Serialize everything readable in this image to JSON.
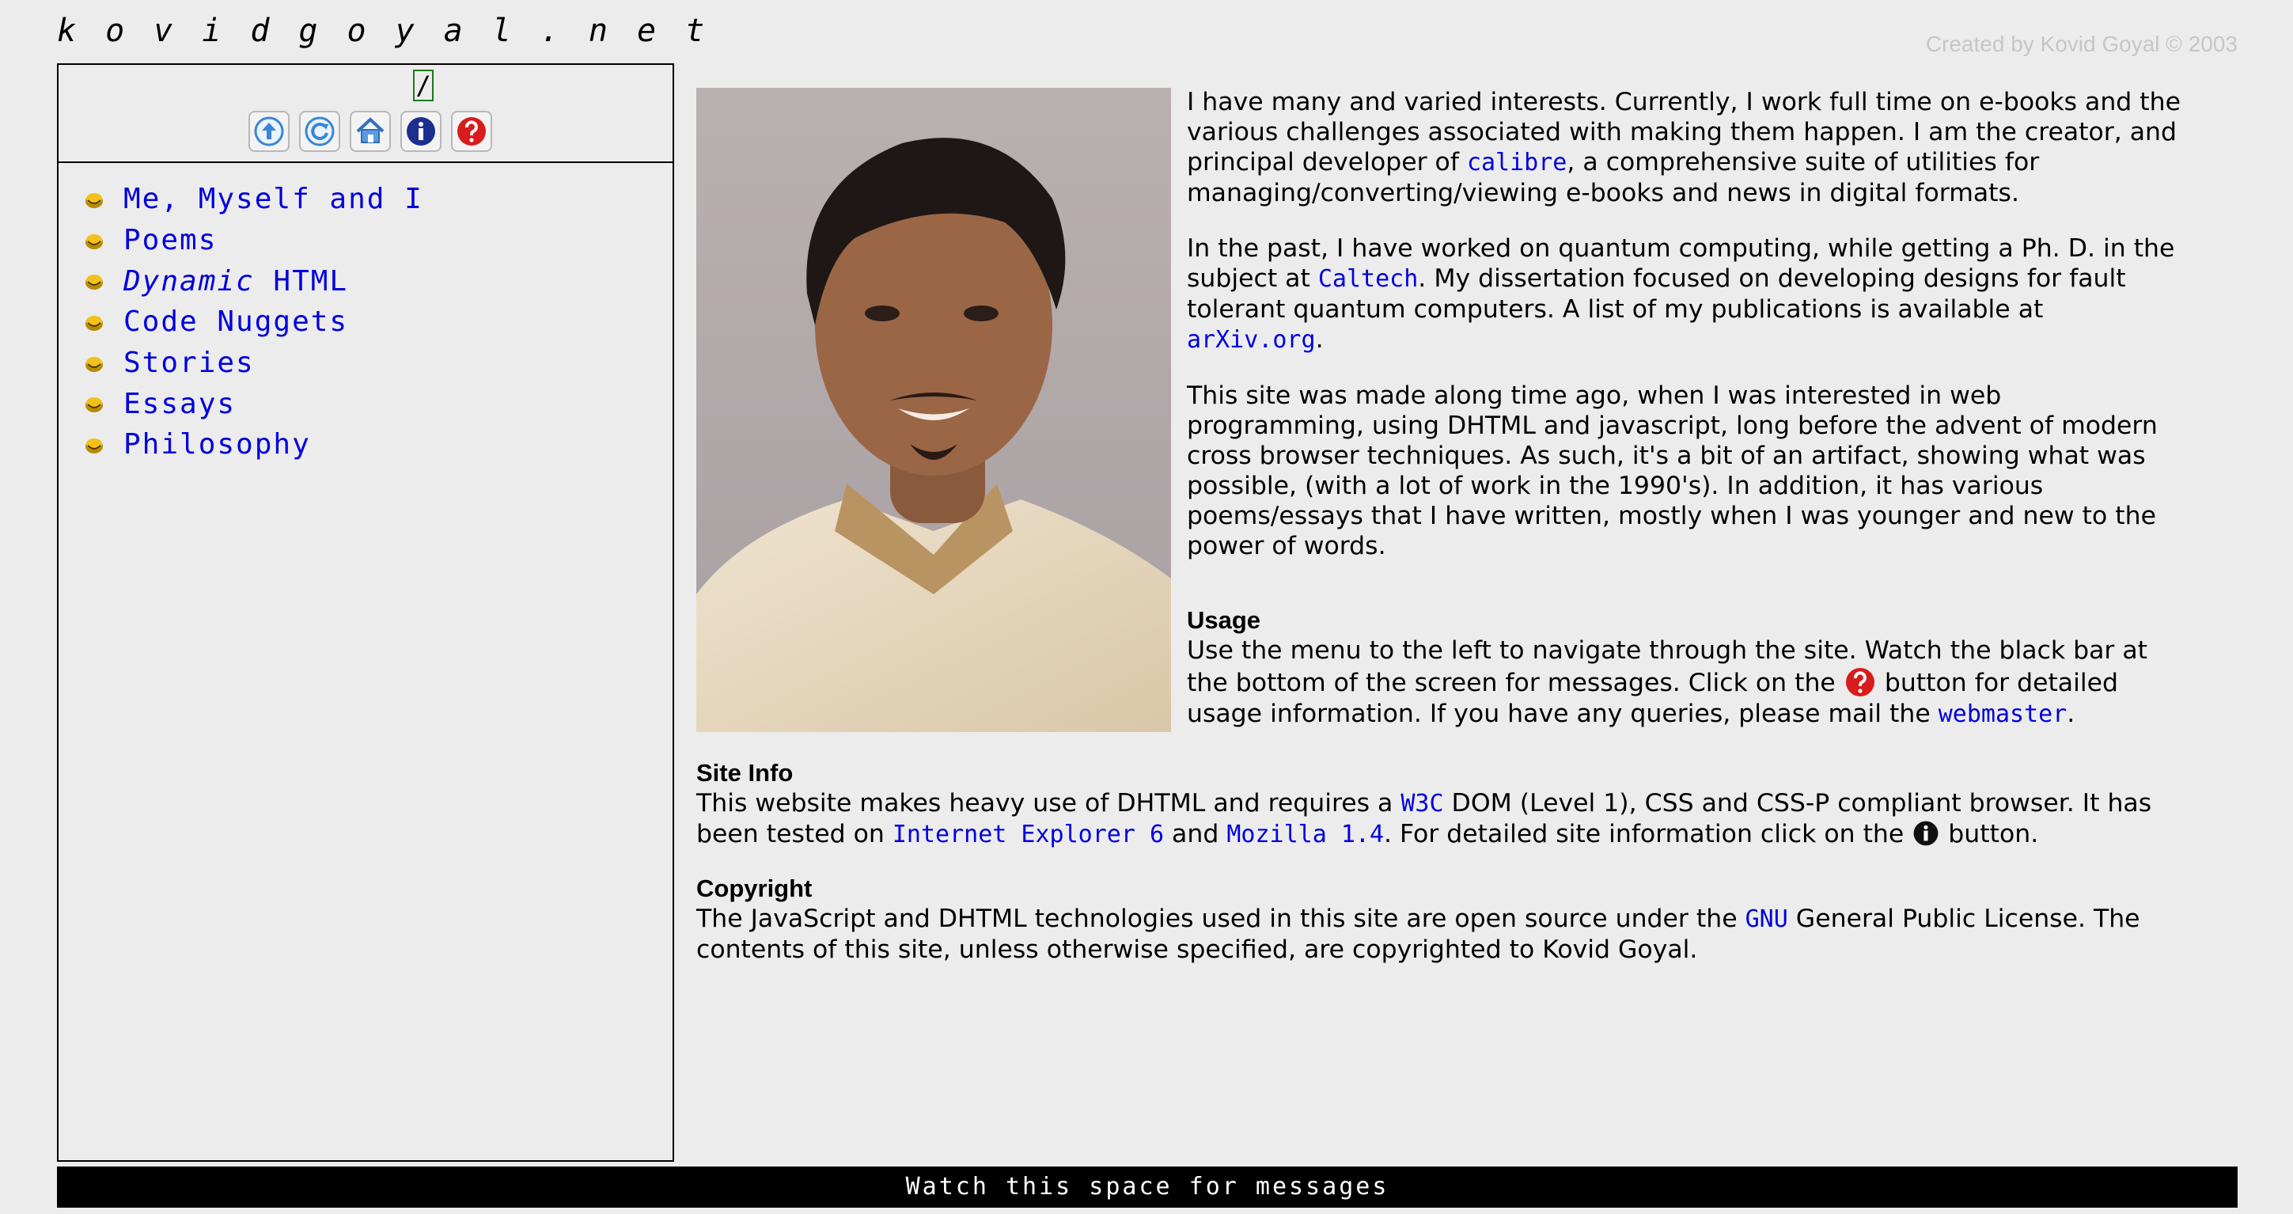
{
  "site": {
    "title": "kovidgoyal.net",
    "credit": "Created by Kovid Goyal © 2003"
  },
  "sidebar": {
    "path": "/",
    "toolbar": [
      {
        "icon": "up-arrow-icon"
      },
      {
        "icon": "reload-icon"
      },
      {
        "icon": "home-icon"
      },
      {
        "icon": "info-icon"
      },
      {
        "icon": "help-icon"
      }
    ],
    "menu": [
      {
        "label": "Me, Myself and I"
      },
      {
        "label": "Poems"
      },
      {
        "label_italic": "Dynamic",
        "label": " HTML"
      },
      {
        "label": "Code Nuggets"
      },
      {
        "label": "Stories"
      },
      {
        "label": "Essays"
      },
      {
        "label": "Philosophy"
      }
    ]
  },
  "intro": {
    "p1_a": "I have many and varied interests. Currently, I work full time on e-books and the various challenges associated with making them happen. I am the creator, and principal developer of ",
    "p1_link": "calibre",
    "p1_b": ", a comprehensive suite of utilities for managing/converting/viewing e-books and news in digital formats.",
    "p2_a": "In the past, I have worked on quantum computing, while getting a Ph. D. in the subject at ",
    "p2_link1": "Caltech",
    "p2_b": ". My dissertation focused on developing designs for fault tolerant quantum computers. A list of my publications is available at ",
    "p2_link2": "arXiv.org",
    "p2_c": ".",
    "p3": "This site was made along time ago, when I was interested in web programming, using DHTML and javascript, long before the advent of modern cross browser techniques. As such, it's a bit of an artifact, showing what was possible, (with a lot of work in the 1990's). In addition, it has various poems/essays that I have written, mostly when I was younger and new to the power of words."
  },
  "usage": {
    "heading": "Usage",
    "text_a": "Use the menu to the left to navigate through the site. Watch the black bar at the bottom of the screen for messages. Click on the ",
    "text_b": " button for detailed usage information. If you have any queries, please mail the ",
    "link": "webmaster",
    "text_c": "."
  },
  "site_info": {
    "heading": "Site Info",
    "text_a": "This website makes heavy use of DHTML and requires a ",
    "link_w3c": "W3C",
    "text_b": " DOM (Level 1), CSS and CSS-P compliant browser. It has been tested on ",
    "link_ie": "Internet Explorer 6",
    "text_c": " and ",
    "link_moz": "Mozilla 1.4",
    "text_d": ". For detailed site information click on the ",
    "text_e": " button."
  },
  "copyright": {
    "heading": "Copyright",
    "text_a": "The JavaScript and DHTML technologies used in this site are open source under the ",
    "link_gnu": "GNU",
    "text_b": " General Public License. The contents of this site, unless otherwise specified, are copyrighted to Kovid Goyal."
  },
  "status": {
    "message": "Watch this space for messages"
  },
  "colors": {
    "link": "#0000dd",
    "status_bg": "#000000",
    "page_bg": "#ececec"
  }
}
